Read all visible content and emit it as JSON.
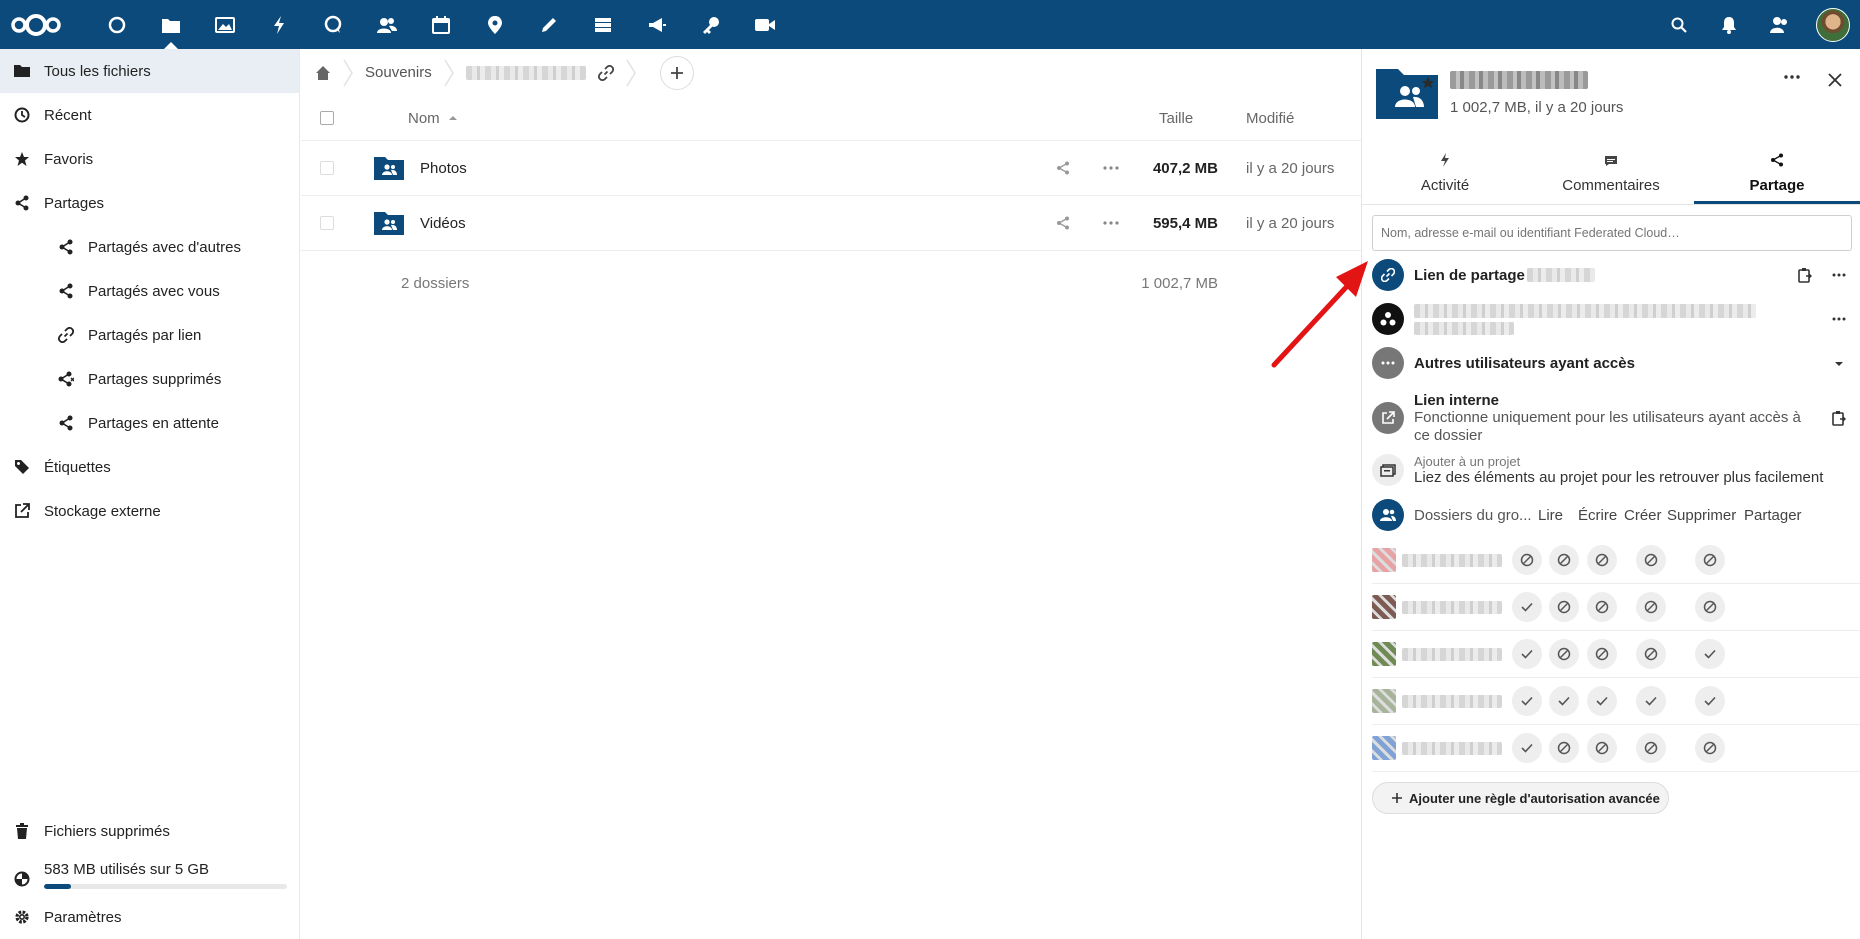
{
  "header": {
    "apps": [
      "dashboard",
      "files",
      "photos",
      "activity",
      "talk",
      "contacts",
      "calendar",
      "maps",
      "notes",
      "deck",
      "announcements",
      "passwords",
      "video"
    ],
    "active_app": "files",
    "right_icons": [
      "search-icon",
      "bell-icon",
      "contacts-icon"
    ],
    "colors": {
      "primary": "#0b4a7a"
    }
  },
  "sidebar": {
    "items": [
      {
        "label": "Tous les fichiers",
        "icon": "folder-icon",
        "active": true
      },
      {
        "label": "Récent",
        "icon": "clock-icon"
      },
      {
        "label": "Favoris",
        "icon": "star-icon"
      },
      {
        "label": "Partages",
        "icon": "share-icon"
      },
      {
        "label": "Partagés avec d'autres",
        "icon": "share-icon",
        "sub": true
      },
      {
        "label": "Partagés avec vous",
        "icon": "share-icon",
        "sub": true
      },
      {
        "label": "Partagés par lien",
        "icon": "link-icon",
        "sub": true
      },
      {
        "label": "Partages supprimés",
        "icon": "share-deleted-icon",
        "sub": true
      },
      {
        "label": "Partages en attente",
        "icon": "share-icon",
        "sub": true
      },
      {
        "label": "Étiquettes",
        "icon": "tag-icon"
      },
      {
        "label": "Stockage externe",
        "icon": "external-icon"
      }
    ],
    "deleted_label": "Fichiers supprimés",
    "quota_label": "583 MB utilisés sur 5 GB",
    "quota_fraction": 0.11,
    "settings_label": "Paramètres"
  },
  "breadcrumb": {
    "items": [
      "Souvenirs"
    ]
  },
  "file_list": {
    "headers": {
      "name": "Nom",
      "size": "Taille",
      "modified": "Modifié"
    },
    "rows": [
      {
        "name": "Photos",
        "size": "407,2 MB",
        "modified": "il y a 20 jours"
      },
      {
        "name": "Vidéos",
        "size": "595,4 MB",
        "modified": "il y a 20 jours"
      }
    ],
    "summary": {
      "count": "2 dossiers",
      "size": "1 002,7 MB"
    }
  },
  "panel": {
    "subtitle": "1 002,7 MB, il y a 20 jours",
    "tabs": [
      {
        "label": "Activité",
        "icon": "bolt-icon"
      },
      {
        "label": "Commentaires",
        "icon": "comment-icon"
      },
      {
        "label": "Partage",
        "icon": "share-icon",
        "active": true
      }
    ],
    "search_placeholder": "Nom, adresse e-mail ou identifiant Federated Cloud…",
    "share_link_label": "Lien de partage",
    "others_label": "Autres utilisateurs ayant accès",
    "internal_link": {
      "title": "Lien interne",
      "desc": "Fonctionne uniquement pour les utilisateurs ayant accès à ce dossier"
    },
    "project": {
      "title": "Ajouter à un projet",
      "desc": "Liez des éléments au projet pour les retrouver plus facilement"
    },
    "group_folders": {
      "label": "Dossiers du gro...",
      "columns": [
        "Lire",
        "Écrire",
        "Créer",
        "Supprimer",
        "Partager"
      ],
      "rows": [
        {
          "avatar_color": "#e7a3a3",
          "perms": [
            false,
            false,
            false,
            false,
            false
          ]
        },
        {
          "avatar_color": "#7d5a52",
          "perms": [
            true,
            false,
            false,
            false,
            false
          ]
        },
        {
          "avatar_color": "#6f8a52",
          "perms": [
            true,
            false,
            false,
            false,
            true
          ]
        },
        {
          "avatar_color": "#a7b49a",
          "perms": [
            true,
            true,
            true,
            true,
            true
          ]
        },
        {
          "avatar_color": "#7fa3d6",
          "perms": [
            true,
            false,
            false,
            false,
            false
          ]
        }
      ]
    },
    "advanced_rule_label": "Ajouter une règle d'autorisation avancée"
  }
}
